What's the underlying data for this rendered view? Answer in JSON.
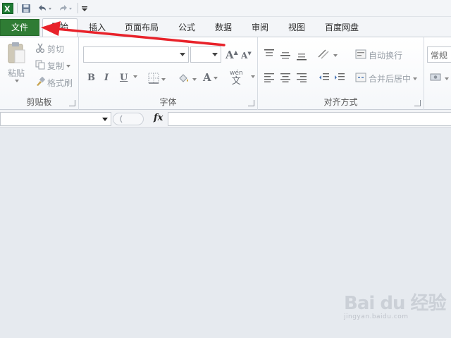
{
  "quick_access": {
    "app_icon": "excel-icon",
    "save_icon": "save-icon",
    "undo_icon": "undo-icon",
    "redo_icon": "redo-icon",
    "customize_icon": "customize-qat-icon"
  },
  "tabs": [
    {
      "label": "文件",
      "name": "tab-file"
    },
    {
      "label": "开始",
      "name": "tab-home"
    },
    {
      "label": "插入",
      "name": "tab-insert"
    },
    {
      "label": "页面布局",
      "name": "tab-page-layout"
    },
    {
      "label": "公式",
      "name": "tab-formulas"
    },
    {
      "label": "数据",
      "name": "tab-data"
    },
    {
      "label": "审阅",
      "name": "tab-review"
    },
    {
      "label": "视图",
      "name": "tab-view"
    },
    {
      "label": "百度网盘",
      "name": "tab-baidu-netdisk"
    }
  ],
  "clipboard": {
    "group_label": "剪贴板",
    "paste": "粘贴",
    "cut": "剪切",
    "copy": "复制",
    "format_painter": "格式刷"
  },
  "font": {
    "group_label": "字体",
    "font_name": "",
    "font_size": "",
    "bold": "B",
    "italic": "I",
    "underline": "U",
    "grow": "A",
    "shrink": "A",
    "font_color": "A",
    "phonetic": "wén"
  },
  "alignment": {
    "group_label": "对齐方式",
    "wrap_text": "自动换行",
    "merge_center": "合并后居中"
  },
  "number": {
    "format": "常规"
  },
  "formula_bar": {
    "name_box": "",
    "fx": "fx",
    "formula": ""
  },
  "annotation": {
    "arrow_color": "#e8222a"
  },
  "watermark": {
    "logo": "Bai du 经验",
    "sub": "jingyan.baidu.com"
  },
  "colors": {
    "file_tab": "#2f7c34",
    "ribbon_bg": "#ffffff",
    "workspace_bg": "#e6eaef"
  }
}
